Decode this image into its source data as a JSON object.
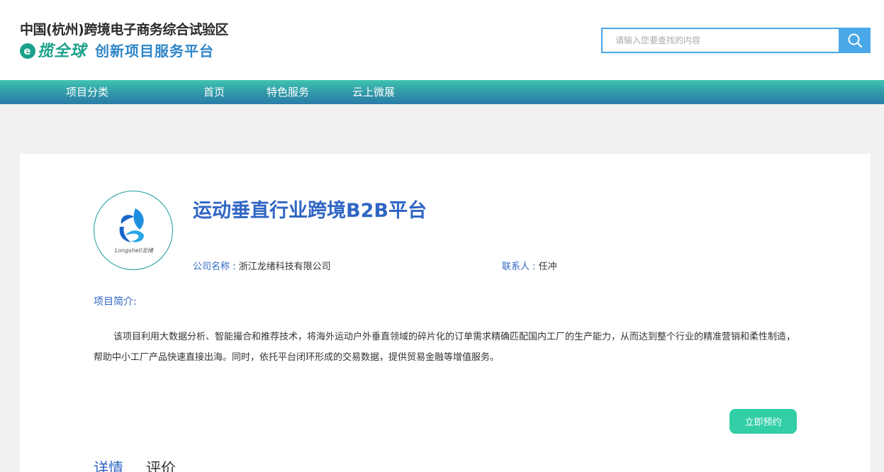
{
  "header": {
    "brand_line1": "中国(杭州)跨境电子商务综合试验区",
    "brand_mark_letter": "e",
    "brand_mark": "揽全球",
    "brand_sub": "创新项目服务平台",
    "search_placeholder": "请输入您要查找的内容",
    "search_icon": "search-icon"
  },
  "nav": {
    "category": "项目分类",
    "items": [
      "首页",
      "特色服务",
      "云上微展"
    ]
  },
  "project": {
    "logo_text": "Longshell龙绪",
    "title": "运动垂直行业跨境B2B平台",
    "company_label": "公司名称 :",
    "company_value": "浙江龙绪科技有限公司",
    "contact_label": "联系人 :",
    "contact_value": "任冲",
    "intro_heading": "项目简介:",
    "intro_text": "该项目利用大数据分析、智能撮合和推荐技术，将海外运动户外垂直领域的碎片化的订单需求精确匹配国内工厂的生产能力，从而达到整个行业的精准营销和柔性制造，帮助中小工厂产品快速直接出海。同时，依托平台闭环形成的交易数据，提供贸易金融等增值服务。",
    "reserve_button": "立即预约"
  },
  "tabs": [
    "详情",
    "评价"
  ],
  "colors": {
    "accent_blue": "#3066c4",
    "search_blue": "#4aa8e8",
    "button_green": "#32cfa6",
    "nav_gradient_top": "#3fc3b1",
    "nav_gradient_bottom": "#2b7cab"
  }
}
